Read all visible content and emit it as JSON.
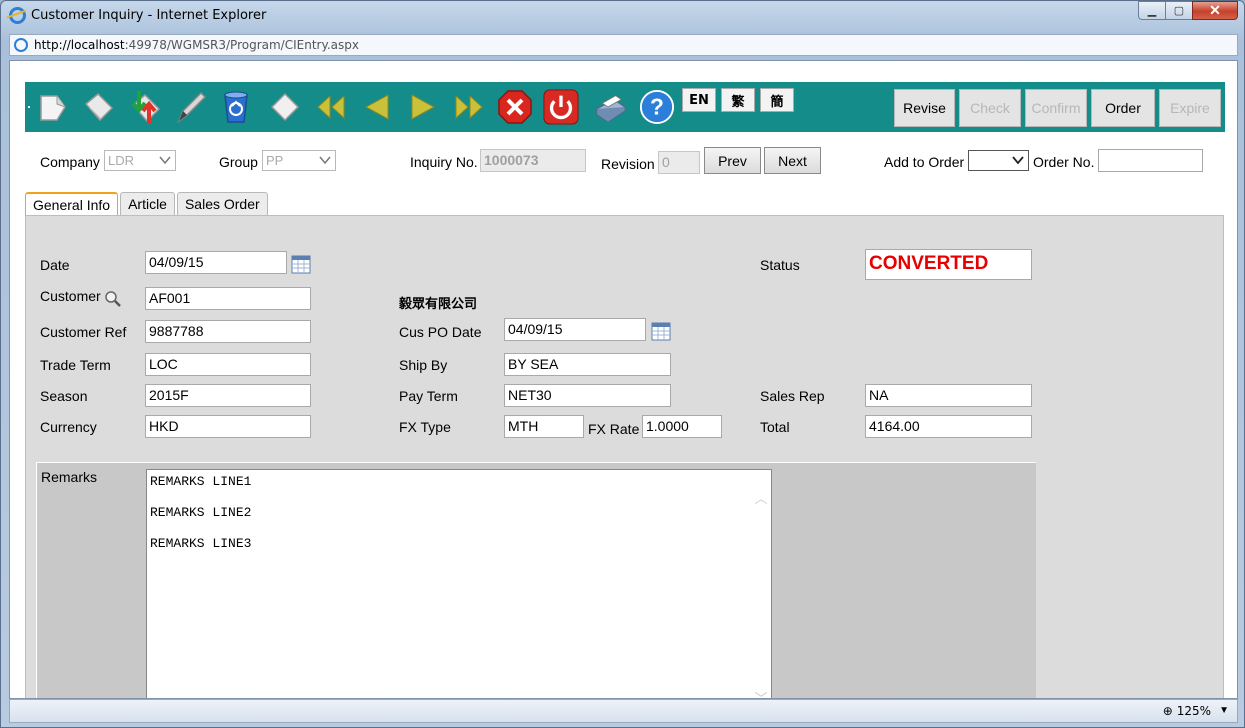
{
  "window": {
    "title": "Customer Inquiry - Internet Explorer",
    "address_host": "http://localhost",
    "address_path": ":49978/WGMSR3/Program/CIEntry.aspx",
    "zoom": "125%"
  },
  "toolbar": {
    "icons": [
      "new-document-icon",
      "copy-document-icon",
      "save-arrows-icon",
      "edit-pencil-icon",
      "recycle-delete-icon",
      "eraser-icon",
      "first-record-icon",
      "previous-record-icon",
      "next-record-icon",
      "last-record-icon",
      "cancel-x-icon",
      "power-exit-icon",
      "printer-icon",
      "help-icon"
    ],
    "lang": [
      "EN",
      "繁",
      "簡"
    ],
    "actions": [
      {
        "label": "Revise",
        "enabled": true
      },
      {
        "label": "Check",
        "enabled": false
      },
      {
        "label": "Confirm",
        "enabled": false
      },
      {
        "label": "Order",
        "enabled": true
      },
      {
        "label": "Expire",
        "enabled": false
      }
    ],
    "accent_color": "#138c8a"
  },
  "header": {
    "company_label": "Company",
    "company_value": "LDR",
    "group_label": "Group",
    "group_value": "PP",
    "inquiry_label": "Inquiry No.",
    "inquiry_value": "1000073",
    "revision_label": "Revision",
    "revision_value": "0",
    "prev_label": "Prev",
    "next_label": "Next",
    "add_to_order_label": "Add to Order",
    "add_to_order_value": "",
    "order_no_label": "Order No.",
    "order_no_value": ""
  },
  "tabs": [
    "General Info",
    "Article",
    "Sales Order"
  ],
  "form": {
    "date_label": "Date",
    "date_value": "04/09/15",
    "customer_label": "Customer",
    "customer_value": "AF001",
    "customer_name": "毅眾有限公司",
    "customer_ref_label": "Customer Ref",
    "customer_ref_value": "9887788",
    "trade_term_label": "Trade Term",
    "trade_term_value": "LOC",
    "season_label": "Season",
    "season_value": "2015F",
    "currency_label": "Currency",
    "currency_value": "HKD",
    "cus_po_date_label": "Cus PO Date",
    "cus_po_date_value": "04/09/15",
    "ship_by_label": "Ship By",
    "ship_by_value": "BY SEA",
    "pay_term_label": "Pay Term",
    "pay_term_value": "NET30",
    "fx_type_label": "FX Type",
    "fx_type_value": "MTH",
    "fx_rate_label": "FX Rate",
    "fx_rate_value": "1.0000",
    "status_label": "Status",
    "status_value": "CONVERTED",
    "sales_rep_label": "Sales Rep",
    "sales_rep_value": "NA",
    "total_label": "Total",
    "total_value": "4164.00",
    "remarks_label": "Remarks",
    "remarks_lines": [
      "REMARKS LINE1",
      "REMARKS LINE2",
      "REMARKS LINE3"
    ],
    "status_color": "#e60000"
  }
}
